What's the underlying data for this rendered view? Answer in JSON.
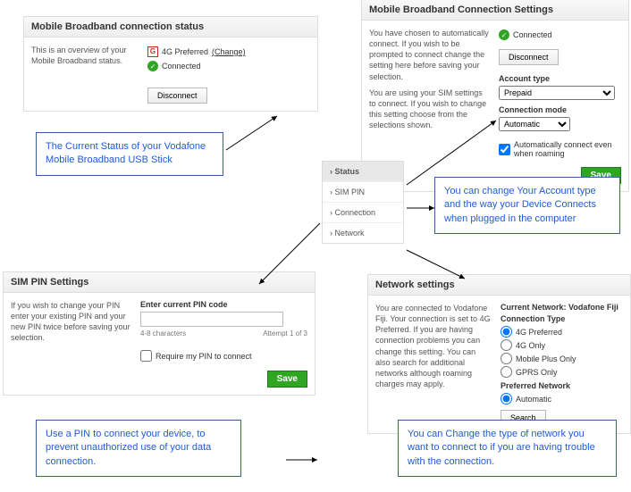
{
  "status_panel": {
    "title": "Mobile Broadband connection status",
    "desc": "This is an overview of your Mobile Broadband status.",
    "pref_line": "4G Preferred",
    "change": "(Change)",
    "connected": "Connected",
    "disconnect": "Disconnect"
  },
  "settings_panel": {
    "title": "Mobile Broadband Connection Settings",
    "desc1": "You have chosen to automatically connect. If you wish to be prompted to connect change the setting here before saving your selection.",
    "desc2": "You are using your SIM settings to connect. If you wish to change this setting choose from the selections shown.",
    "connected": "Connected",
    "disconnect": "Disconnect",
    "account_type_label": "Account type",
    "account_type_value": "Prepaid",
    "conn_mode_label": "Connection mode",
    "conn_mode_value": "Automatic",
    "roaming": "Automatically connect even when roaming",
    "save": "Save"
  },
  "nav": {
    "status": "Status",
    "sim_pin": "SIM PIN",
    "connection": "Connection",
    "network": "Network"
  },
  "sim_panel": {
    "title": "SIM PIN Settings",
    "desc": "If you wish to change your PIN enter your existing PIN and your new PIN twice before saving your selection.",
    "enter_label": "Enter current PIN code",
    "chars": "4-8 characters",
    "attempt": "Attempt 1 of 3",
    "require": "Require my PIN to connect",
    "save": "Save"
  },
  "network_panel": {
    "title": "Network settings",
    "desc": "You are connected to Vodafone Fiji. Your connection is set to 4G Preferred. If you are having connection problems you can change this setting. You can also search for additional networks although roaming charges may apply.",
    "current_label": "Current Network: Vodafone Fiji",
    "conn_type_label": "Connection Type",
    "opt_4g_pref": "4G Preferred",
    "opt_4g_only": "4G Only",
    "opt_mobile_plus": "Mobile Plus Only",
    "opt_gprs": "GPRS Only",
    "pref_net_label": "Preferred Network",
    "opt_auto": "Automatic",
    "search": "Search"
  },
  "callouts": {
    "c1": "The Current Status of your Vodafone Mobile Broadband USB Stick",
    "c2": "You can change Your Account type and the way your Device Connects when plugged in the computer",
    "c3": "Use a PIN to connect your device, to prevent unauthorized use of your data connection.",
    "c4": "You can Change the type of network you want to connect to if you are having trouble with the connection."
  },
  "icons": {
    "check": "✓"
  }
}
